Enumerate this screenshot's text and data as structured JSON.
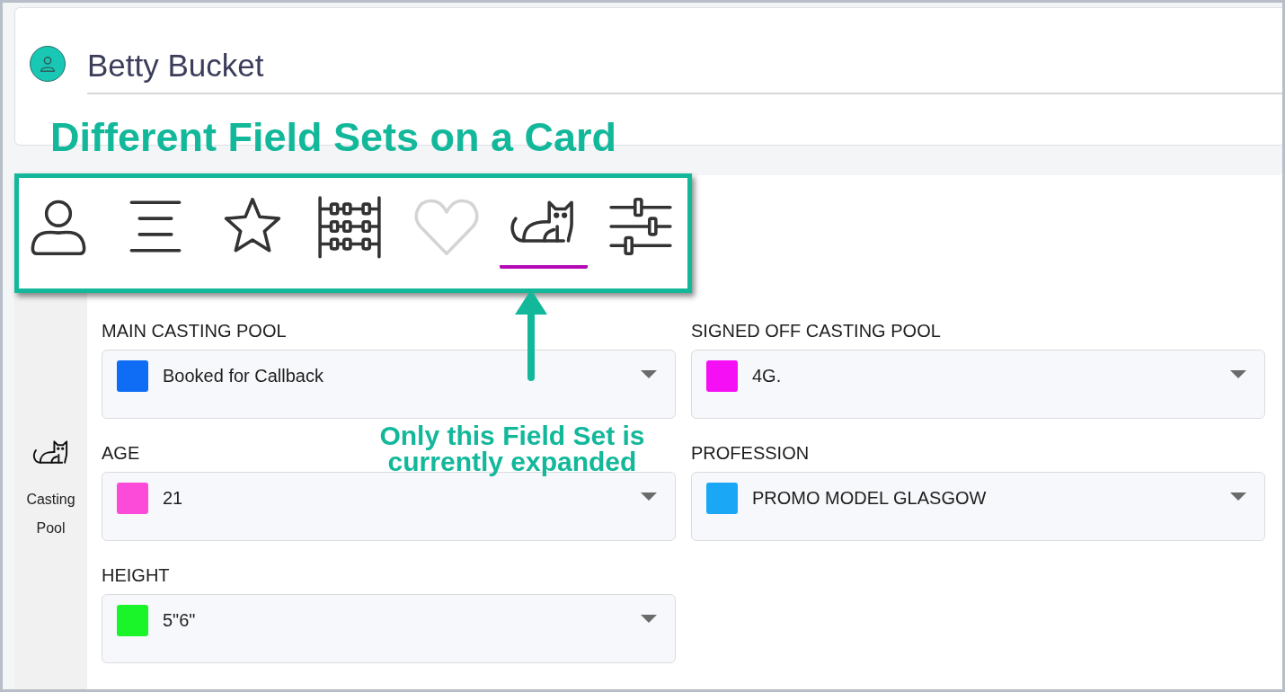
{
  "header": {
    "name": "Betty Bucket"
  },
  "annotation_title": "Different Field Sets on a Card",
  "field_set_tabs": [
    {
      "kind": "person",
      "selected": false,
      "disabled": false
    },
    {
      "kind": "lines",
      "selected": false,
      "disabled": false
    },
    {
      "kind": "star",
      "selected": false,
      "disabled": false
    },
    {
      "kind": "abacus",
      "selected": false,
      "disabled": false
    },
    {
      "kind": "heart",
      "selected": false,
      "disabled": true
    },
    {
      "kind": "cat",
      "selected": true,
      "disabled": false
    },
    {
      "kind": "sliders",
      "selected": false,
      "disabled": false
    }
  ],
  "sidebar": {
    "label": "Casting Pool"
  },
  "fields": [
    {
      "label": "MAIN CASTING POOL",
      "value": "Booked for Callback",
      "color": "#0f6cf5"
    },
    {
      "label": "SIGNED OFF CASTING POOL",
      "value": "4G.",
      "color": "#f50ff5"
    },
    {
      "label": "AGE",
      "value": "21",
      "color": "#fb4bd8"
    },
    {
      "label": "PROFESSION",
      "value": "PROMO MODEL GLASGOW",
      "color": "#1aa7f5"
    },
    {
      "label": "HEIGHT",
      "value": "5\"6\"",
      "color": "#1af52a"
    }
  ],
  "annotation_note": "Only this Field Set is currently expanded"
}
